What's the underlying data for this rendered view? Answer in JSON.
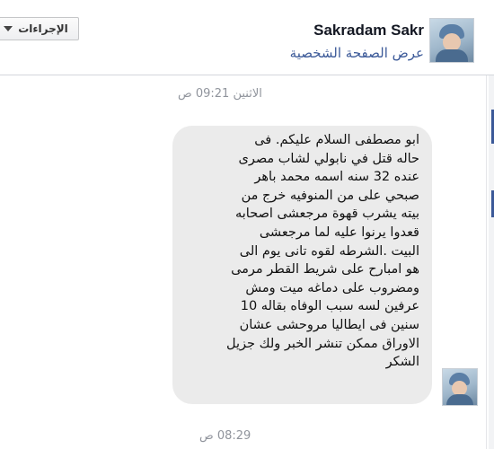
{
  "header": {
    "actions_label": "الإجراءات",
    "user_name": "Sakradam Sakr",
    "view_profile": "عرض الصفحة الشخصية"
  },
  "conversation": {
    "first_timestamp": "الاثنين 09:21 ص",
    "message_lines": [
      "ابو مصطفى السلام عليكم. فى",
      "حاله قتل في نابولي لشاب مصرى",
      "عنده 32 سنه اسمه محمد باهر",
      "صبحي على من المنوفيه خرج من",
      "بيته يشرب قهوة مرجعشى اصحابه",
      "قعدوا يرنوا عليه لما مرجعشى",
      "البيت .الشرطه لقوه تانى يوم الى",
      "هو امبارح على شريط القطر مرمى",
      "ومضروب على دماغه ميت ومش",
      "عرفين لسه سبب الوفاه بقاله 10",
      "سنين فى ايطاليا مروحشى عشان",
      "الاوراق ممكن تنشر الخبر ولك جزيل",
      "الشكر"
    ],
    "second_timestamp": "08:29 ص"
  },
  "colors": {
    "link": "#3b5998",
    "bubble": "#ebebeb",
    "timestamp": "#90949c"
  }
}
